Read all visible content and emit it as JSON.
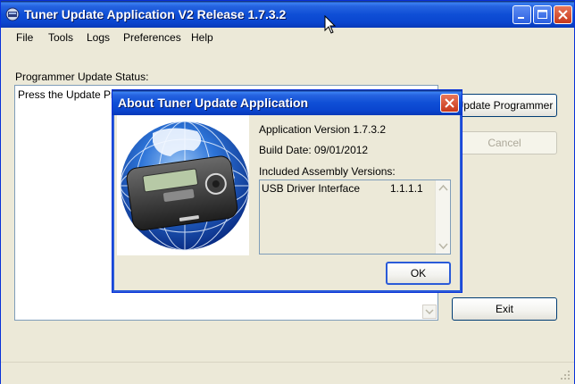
{
  "window": {
    "title": "Tuner Update Application V2 Release 1.7.3.2"
  },
  "menu": [
    "File",
    "Tools",
    "Logs",
    "Preferences",
    "Help"
  ],
  "main": {
    "status_label": "Programmer Update Status:",
    "status_text": "Press the Update Prog",
    "buttons": {
      "update": "Update Programmer",
      "cancel": "Cancel",
      "exit": "Exit"
    }
  },
  "dialog": {
    "title": "About Tuner Update Application",
    "app_version": "Application Version 1.7.3.2",
    "build_date": "Build Date: 09/01/2012",
    "assemblies_label": "Included Assembly Versions:",
    "assemblies": [
      {
        "name": "USB Driver Interface",
        "version": "1.1.1.1"
      }
    ],
    "ok_label": "OK"
  },
  "colors": {
    "titlebar_blue": "#0A45CF",
    "close_red": "#C7381B",
    "window_face": "#ECE9D8"
  }
}
